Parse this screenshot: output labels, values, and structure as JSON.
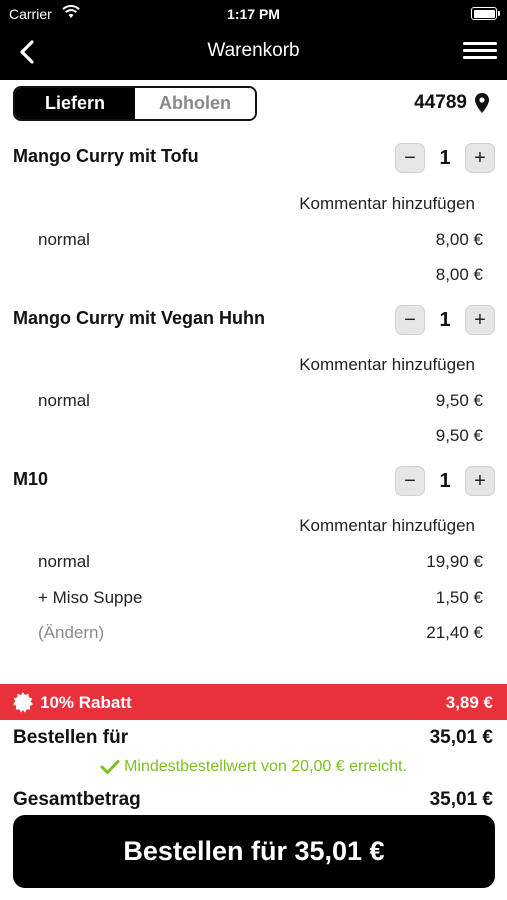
{
  "status": {
    "carrier": "Carrier",
    "time": "1:17 PM"
  },
  "nav": {
    "title": "Warenkorb",
    "back_icon": "chevron-left-icon",
    "menu_icon": "hamburger-menu-icon"
  },
  "delivery": {
    "options": [
      "Liefern",
      "Abholen"
    ],
    "selected": "Liefern",
    "zip": "44789"
  },
  "items": [
    {
      "name": "Mango Curry mit Tofu",
      "quantity": "1",
      "comment_label": "Kommentar hinzufügen",
      "lines": [
        {
          "label": "normal",
          "price": "8,00 €"
        }
      ],
      "total": "8,00 €"
    },
    {
      "name": "Mango Curry mit Vegan Huhn",
      "quantity": "1",
      "comment_label": "Kommentar hinzufügen",
      "lines": [
        {
          "label": "normal",
          "price": "9,50 €"
        }
      ],
      "total": "9,50 €"
    },
    {
      "name": "M10",
      "quantity": "1",
      "comment_label": "Kommentar hinzufügen",
      "lines": [
        {
          "label": "normal",
          "price": "19,90 €"
        },
        {
          "label": "+ Miso Suppe",
          "price": "1,50 €"
        }
      ],
      "edit_label": "(Ändern)",
      "total": "21,40 €"
    }
  ],
  "discount": {
    "label": "10% Rabatt",
    "amount": "3,89 €",
    "color": "#e8313a"
  },
  "summary": {
    "order_for_label": "Bestellen für",
    "order_for_value": "35,01 €",
    "minimum_note": "Mindestbestellwert von 20,00 € erreicht.",
    "total_label": "Gesamtbetrag",
    "total_value": "35,01 €"
  },
  "order_button": "Bestellen für 35,01 €",
  "colors": {
    "accent_green": "#7cc021",
    "header": "#000000"
  }
}
